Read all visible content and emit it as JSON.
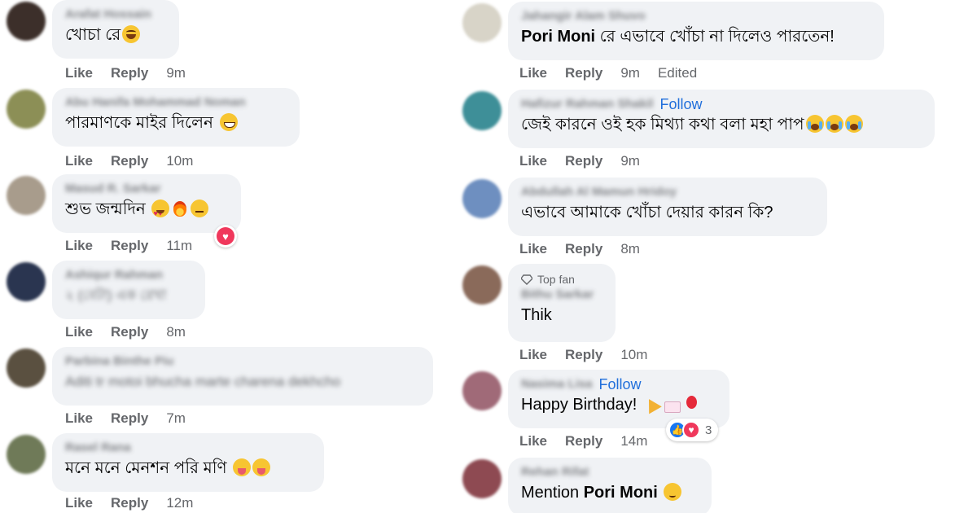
{
  "left_comments": [
    {
      "author": "Arafat Hossain",
      "text": "খোচা রে",
      "emojis": [
        "laugh"
      ],
      "time": "9m"
    },
    {
      "author": "Abu Hanifa Mohammad Noman",
      "text": "পারমাণকে মাইর দিলেন",
      "emojis": [
        "grin"
      ],
      "time": "10m"
    },
    {
      "author": "Masud R. Sarkar",
      "text": "শুভ জন্মদিন",
      "emojis": [
        "love",
        "fire",
        "meh"
      ],
      "time": "11m",
      "reaction": "love"
    },
    {
      "author": "Ashiqur Rahman",
      "text": "২ (বেটা) এক রেখা",
      "text_blurred": true,
      "emojis": [],
      "time": "8m"
    },
    {
      "author": "Parbina Binthe Piu",
      "text": "Aditi tr motoi bhucha marte charena dekhcho",
      "text_blurred": true,
      "emojis": [],
      "time": "7m"
    },
    {
      "author": "Rasel Rana",
      "text": "মনে মনে মেনশন পরি মণি",
      "emojis": [
        "tongue",
        "tongue"
      ],
      "time": "12m"
    }
  ],
  "right_comments": [
    {
      "author": "Jahangir Alam Shuvo",
      "text_bold": "Pori Moni",
      "text": " রে এভাবে খোঁচা না দিলেও পারতেন!",
      "emojis": [],
      "time": "9m",
      "edited": "Edited"
    },
    {
      "author": "Hafizur Rahman Shakil",
      "follow": "Follow",
      "text": "জেই কারনে ওই হক মিথ্যা কথা বলা মহা পাপ",
      "emojis": [
        "cry",
        "cry",
        "cry"
      ],
      "time": "9m"
    },
    {
      "author": "Abdullah Al Mamun Hridoy",
      "text": "এভাবে আমাকে খোঁচা দেয়ার কারন কি?",
      "emojis": [],
      "time": "8m"
    },
    {
      "badge": "Top fan",
      "author": "Bithu Sarkar",
      "text": "Thik",
      "emojis": [],
      "time": "10m"
    },
    {
      "author": "Nasima Lisa",
      "follow": "Follow",
      "text": "Happy Birthday! ",
      "emojis": [
        "party",
        "cake",
        "balloon"
      ],
      "time": "14m",
      "reaction_count": "3"
    },
    {
      "author": "Rehan Rifat",
      "text": "Mention ",
      "text_bold_after": "Pori Moni",
      "emojis": [
        "relieved"
      ],
      "time": ""
    }
  ],
  "labels": {
    "like": "Like",
    "reply": "Reply"
  },
  "colors": {
    "bubble": "#f0f2f5",
    "meta": "#65676b",
    "link": "#216fdb"
  }
}
